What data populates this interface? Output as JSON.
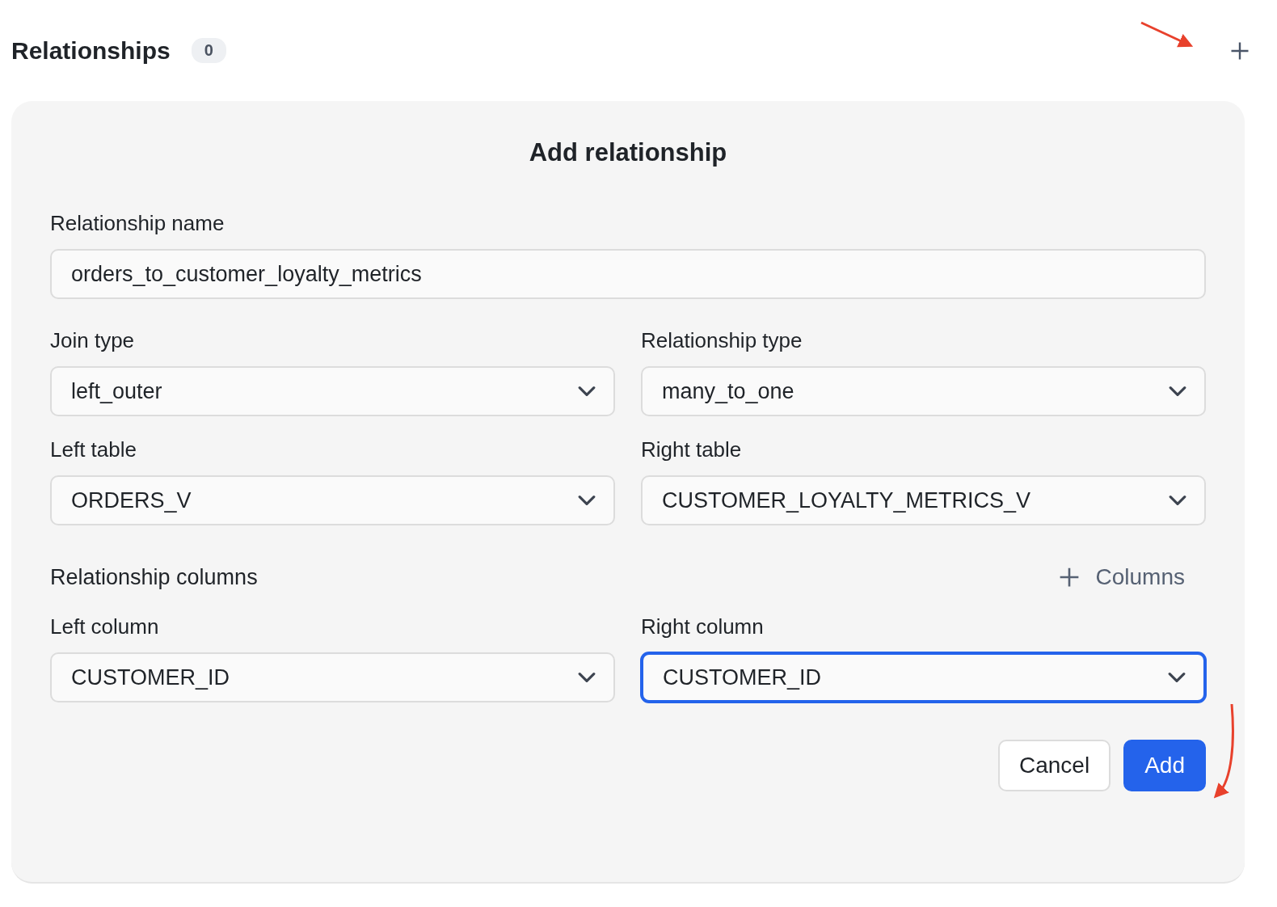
{
  "header": {
    "title": "Relationships",
    "count": "0"
  },
  "form": {
    "title": "Add relationship",
    "name_field": {
      "label": "Relationship name",
      "value": "orders_to_customer_loyalty_metrics"
    },
    "rows": [
      [
        {
          "label": "Join type",
          "value": "left_outer",
          "focused": false
        },
        {
          "label": "Relationship type",
          "value": "many_to_one",
          "focused": false
        }
      ],
      [
        {
          "label": "Left table",
          "value": "ORDERS_V",
          "focused": false
        },
        {
          "label": "Right table",
          "value": "CUSTOMER_LOYALTY_METRICS_V",
          "focused": false
        }
      ]
    ],
    "columns_section": {
      "label": "Relationship columns",
      "add_button": "Columns"
    },
    "column_rows": [
      [
        {
          "label": "Left column",
          "value": "CUSTOMER_ID",
          "focused": false
        },
        {
          "label": "Right column",
          "value": "CUSTOMER_ID",
          "focused": true
        }
      ]
    ],
    "buttons": [
      {
        "label": "Cancel",
        "kind": "secondary"
      },
      {
        "label": "Add",
        "kind": "primary"
      }
    ]
  }
}
